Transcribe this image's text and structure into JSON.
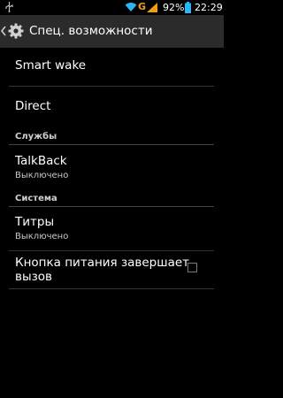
{
  "status_bar": {
    "icons": [
      "usb-icon",
      "wifi-icon",
      "network-g-icon",
      "cell-signal-icon",
      "battery-icon"
    ],
    "network_type": "G",
    "battery_percent": "92%",
    "time": "22:29"
  },
  "action_bar": {
    "title": "Спец. возможности",
    "icons": [
      "back-chevron-icon",
      "gear-icon"
    ]
  },
  "list": {
    "smart_wake": "Smart wake",
    "direct": "Direct",
    "services_header": "Службы",
    "talkback_title": "TalkBack",
    "talkback_summary": "Выключено",
    "system_header": "Система",
    "captions_title": "Титры",
    "captions_summary": "Выключено",
    "power_button_line1": "Кнопка питания завершает",
    "power_button_line2": "вызов",
    "power_button_checked": false
  }
}
